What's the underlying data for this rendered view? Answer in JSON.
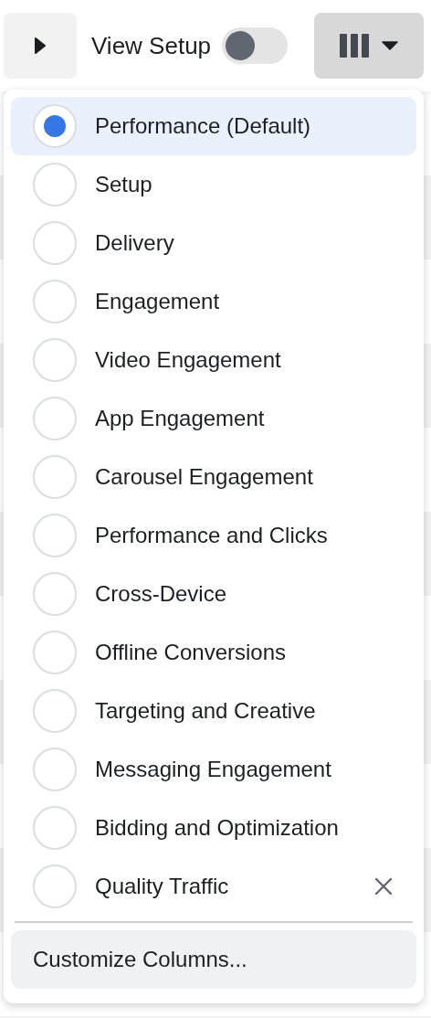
{
  "toolbar": {
    "view_setup": {
      "label": "View Setup",
      "on": false
    }
  },
  "column_menu": {
    "expanded": true,
    "presets": [
      {
        "label": "Performance (Default)",
        "selected": true,
        "removable": false
      },
      {
        "label": "Setup",
        "selected": false,
        "removable": false
      },
      {
        "label": "Delivery",
        "selected": false,
        "removable": false
      },
      {
        "label": "Engagement",
        "selected": false,
        "removable": false
      },
      {
        "label": "Video Engagement",
        "selected": false,
        "removable": false
      },
      {
        "label": "App Engagement",
        "selected": false,
        "removable": false
      },
      {
        "label": "Carousel Engagement",
        "selected": false,
        "removable": false
      },
      {
        "label": "Performance and Clicks",
        "selected": false,
        "removable": false
      },
      {
        "label": "Cross-Device",
        "selected": false,
        "removable": false
      },
      {
        "label": "Offline Conversions",
        "selected": false,
        "removable": false
      },
      {
        "label": "Targeting and Creative",
        "selected": false,
        "removable": false
      },
      {
        "label": "Messaging Engagement",
        "selected": false,
        "removable": false
      },
      {
        "label": "Bidding and Optimization",
        "selected": false,
        "removable": false
      },
      {
        "label": "Quality Traffic",
        "selected": false,
        "removable": true
      }
    ],
    "footer": "Customize Columns..."
  }
}
